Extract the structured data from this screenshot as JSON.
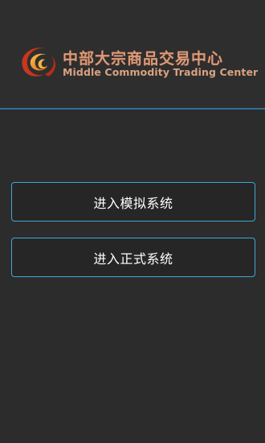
{
  "header": {
    "logo_icon": "flame-swirl-logo-icon",
    "title_cn": "中部大宗商品交易中心",
    "title_en": "Middle Commodity Trading Center"
  },
  "buttons": {
    "simulation_label": "进入模拟系统",
    "live_label": "进入正式系统"
  },
  "colors": {
    "background": "#2c2c2c",
    "divider": "#2f6f9a",
    "button_border": "#3ea8d6",
    "logo_text": "#d99a7a",
    "logo_red": "#c8361f",
    "logo_orange": "#f0a030"
  }
}
